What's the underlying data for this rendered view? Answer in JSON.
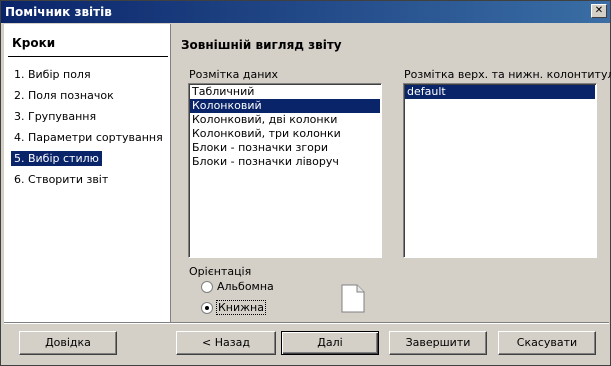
{
  "window": {
    "title": "Помічник звітів",
    "close_glyph": "✕"
  },
  "steps": {
    "heading": "Кроки",
    "items": [
      {
        "label": "1. Вибір поля"
      },
      {
        "label": "2. Поля позначок"
      },
      {
        "label": "3. Групування"
      },
      {
        "label": "4. Параметри сортування"
      },
      {
        "label": "5. Вибір стилю"
      },
      {
        "label": "6. Створити звіт"
      }
    ],
    "active_index": 4
  },
  "main": {
    "title": "Зовнішній вигляд звіту",
    "data_layout": {
      "label": "Розмітка даних",
      "items": [
        {
          "label": "Табличний"
        },
        {
          "label": "Колонковий"
        },
        {
          "label": "Колонковий, дві колонки"
        },
        {
          "label": "Колонковий, три колонки"
        },
        {
          "label": "Блоки - позначки згори"
        },
        {
          "label": "Блоки - позначки ліворуч"
        }
      ],
      "selected_index": 1
    },
    "header_footer_layout": {
      "label": "Розмітка верх. та нижн. колонтитула",
      "items": [
        {
          "label": "default"
        }
      ],
      "selected_index": 0
    },
    "orientation": {
      "label": "Орієнтація",
      "options": [
        {
          "label": "Альбомна"
        },
        {
          "label": "Книжна"
        }
      ],
      "selected_index": 1,
      "preview_icon": "portrait-page-icon"
    }
  },
  "buttons": {
    "help": "Довідка",
    "back": "< Назад",
    "next": "Далі",
    "finish": "Завершити",
    "cancel": "Скасувати"
  },
  "colors": {
    "titlebar": "#0a246a",
    "selection": "#0a246a",
    "dialog_bg": "#d4d0c8"
  }
}
